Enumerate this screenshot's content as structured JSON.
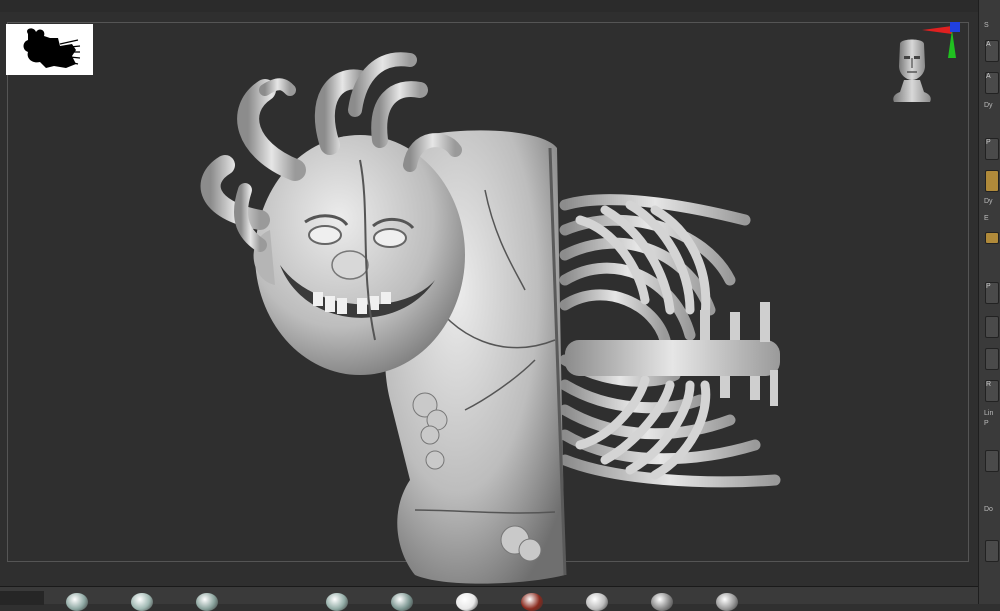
{
  "viewport": {
    "thumbnail_icon": "model-silhouette-thumbnail",
    "axis_icon": "xyz-axis-gizmo-icon",
    "navigation_icon": "head-navigation-gizmo-icon",
    "model_icon": "sculpted-creature-with-ribcage"
  },
  "colors": {
    "viewport_bg": "#2f2f2f",
    "frame": "#555555",
    "clay": "#c8c8c8",
    "axis_x": "#e02020",
    "axis_y": "#20c020",
    "axis_z": "#2040e0",
    "active_button": "#b08a3a"
  },
  "right_panel": {
    "labels": [
      "S",
      "A",
      "A",
      "Dy",
      "P",
      "Dy",
      "E",
      "P",
      "R",
      "Lin",
      "P",
      "Do"
    ]
  },
  "bottom_tray": {
    "brushes": [
      {
        "name": "brush-1",
        "color": "#8fa9a4"
      },
      {
        "name": "brush-2",
        "color": "#9fb8b2"
      },
      {
        "name": "brush-3",
        "color": "#8aa39d"
      },
      {
        "name": "brush-4",
        "color": "#93ada7"
      },
      {
        "name": "brush-5",
        "color": "#7e9893"
      },
      {
        "name": "brush-6",
        "color": "#e8e8e8"
      },
      {
        "name": "brush-7",
        "color": "#8a2a1e"
      },
      {
        "name": "brush-8",
        "color": "#bdbdbd"
      },
      {
        "name": "brush-9",
        "color": "#8a8a8a"
      },
      {
        "name": "brush-10",
        "color": "#9a9a9a"
      }
    ]
  }
}
